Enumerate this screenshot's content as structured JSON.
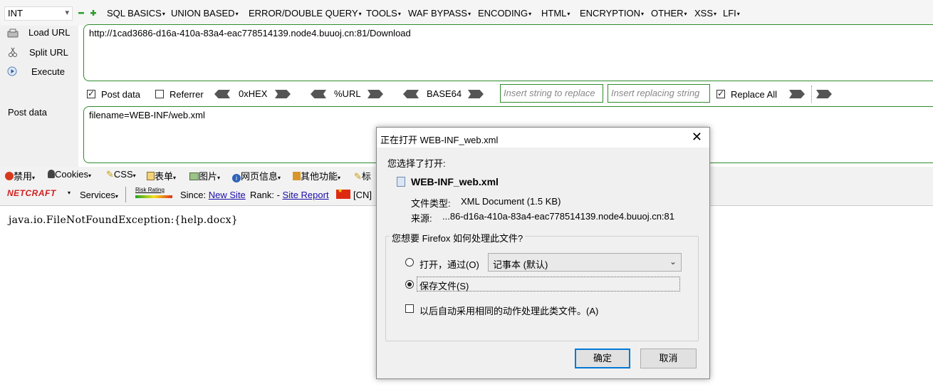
{
  "menubar": {
    "select_value": "INT",
    "items": [
      "SQL BASICS",
      "UNION BASED",
      "ERROR/DOUBLE QUERY",
      "TOOLS",
      "WAF BYPASS",
      "ENCODING",
      "HTML",
      "ENCRYPTION",
      "OTHER",
      "XSS",
      "LFI"
    ]
  },
  "sidebar": {
    "load_url": "Load URL",
    "split_url": "Split URL",
    "execute": "Execute",
    "post_data_label": "Post data"
  },
  "url_field": {
    "value": "http://1cad3686-d16a-410a-83a4-eac778514139.node4.buuoj.cn:81/Download"
  },
  "toolbar": {
    "post_data": {
      "label": "Post data",
      "checked": true
    },
    "referrer": {
      "label": "Referrer",
      "checked": false
    },
    "encoders": [
      "0xHEX",
      "%URL",
      "BASE64"
    ],
    "replace_placeholder": "Insert string to replace",
    "replacing_placeholder": "Insert replacing string",
    "replace_all": {
      "label": "Replace All",
      "checked": true
    }
  },
  "post_field": {
    "value": "filename=WEB-INF/web.xml"
  },
  "devbar": {
    "items": [
      "禁用",
      "Cookies",
      "CSS",
      "表单",
      "图片",
      "网页信息",
      "其他功能",
      "标"
    ]
  },
  "netbar": {
    "logo": "NETCRAFT",
    "services": "Services",
    "risk_rating": "Risk Rating",
    "since_label": "Since:",
    "since_value": "New Site",
    "rank_label": "Rank:",
    "site_report": "Site Report",
    "country": "[CN]"
  },
  "result": {
    "text": "java.io.FileNotFoundException:{help.docx}"
  },
  "dialog": {
    "title": "正在打开 WEB-INF_web.xml",
    "selected_text": "您选择了打开:",
    "filename": "WEB-INF_web.xml",
    "type_label": "文件类型:",
    "type_value": "XML Document (1.5 KB)",
    "source_label": "来源:",
    "source_value": "...86-d16a-410a-83a4-eac778514139.node4.buuoj.cn:81",
    "question": "您想要 Firefox 如何处理此文件?",
    "open_with": "打开，通过(O)",
    "open_with_app": "记事本 (默认)",
    "save_file": "保存文件(S)",
    "auto_remember": "以后自动采用相同的动作处理此类文件。(A)",
    "ok": "确定",
    "cancel": "取消"
  }
}
